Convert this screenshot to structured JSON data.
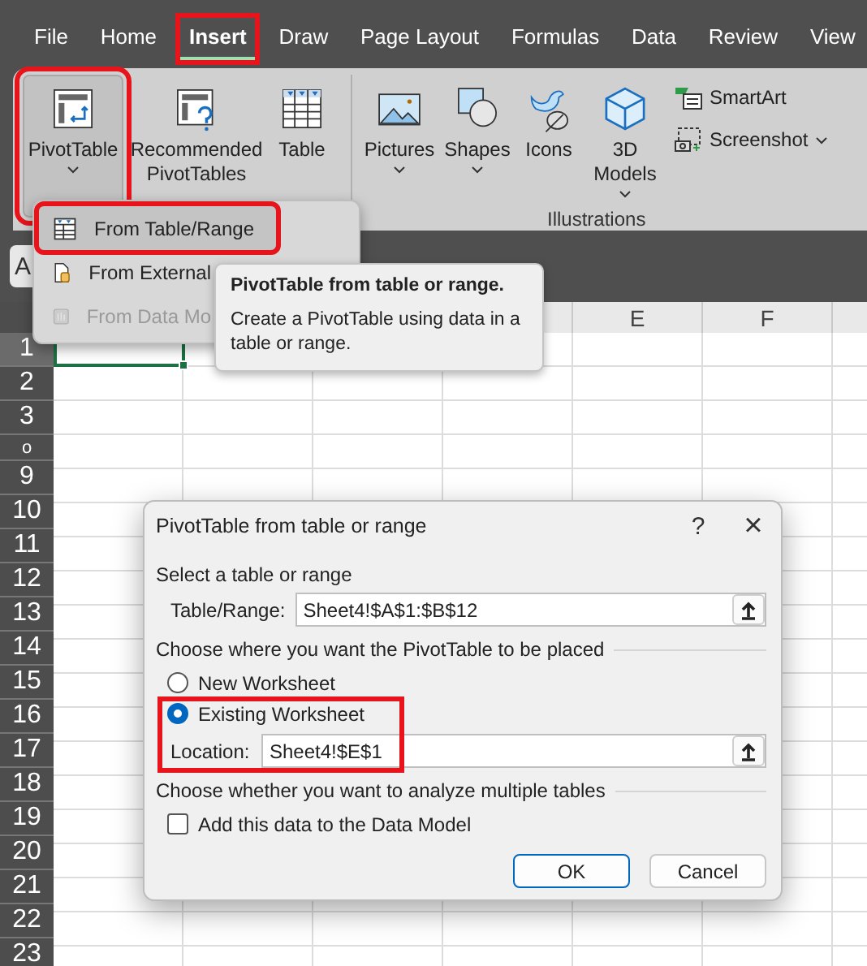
{
  "tabs": [
    {
      "label": "File",
      "selected": false,
      "highlighted": false
    },
    {
      "label": "Home",
      "selected": false,
      "highlighted": false
    },
    {
      "label": "Insert",
      "selected": true,
      "highlighted": true
    },
    {
      "label": "Draw",
      "selected": false,
      "highlighted": false
    },
    {
      "label": "Page Layout",
      "selected": false,
      "highlighted": false
    },
    {
      "label": "Formulas",
      "selected": false,
      "highlighted": false
    },
    {
      "label": "Data",
      "selected": false,
      "highlighted": false
    },
    {
      "label": "Review",
      "selected": false,
      "highlighted": false
    },
    {
      "label": "View",
      "selected": false,
      "highlighted": false
    }
  ],
  "ribbon": {
    "groups": [
      {
        "buttons": [
          {
            "kind": "pivot",
            "label": "PivotTable",
            "caret": true,
            "highlighted": true,
            "pressed": true
          },
          {
            "kind": "recommended",
            "label": "Recommended PivotTables",
            "caret": false,
            "highlighted": false,
            "pressed": false
          },
          {
            "kind": "table",
            "label": "Table",
            "caret": false,
            "highlighted": false,
            "pressed": false
          }
        ]
      },
      {
        "label": "Illustrations",
        "buttons": [
          {
            "kind": "pictures",
            "label": "Pictures",
            "caret": true,
            "highlighted": false,
            "pressed": false
          },
          {
            "kind": "shapes",
            "label": "Shapes",
            "caret": true,
            "highlighted": false,
            "pressed": false
          },
          {
            "kind": "icons",
            "label": "Icons",
            "caret": false,
            "highlighted": false,
            "pressed": false
          },
          {
            "kind": "models",
            "label": "3D Models",
            "caret": true,
            "highlighted": false,
            "pressed": false
          }
        ],
        "small_buttons": [
          {
            "kind": "smartart",
            "label": "SmartArt",
            "caret": false
          },
          {
            "kind": "screenshot",
            "label": "Screenshot",
            "caret": true
          }
        ]
      }
    ]
  },
  "name_box": {
    "value": "A"
  },
  "columns": [
    "E",
    "F"
  ],
  "rows": [
    {
      "label": "1",
      "selected": true,
      "kind": "normal"
    },
    {
      "label": "2",
      "selected": false,
      "kind": "normal"
    },
    {
      "label": "3",
      "selected": false,
      "kind": "normal"
    },
    {
      "label": "o",
      "selected": false,
      "kind": "short"
    },
    {
      "label": "9",
      "selected": false,
      "kind": "normal"
    },
    {
      "label": "10",
      "selected": false,
      "kind": "normal"
    },
    {
      "label": "11",
      "selected": false,
      "kind": "normal"
    },
    {
      "label": "12",
      "selected": false,
      "kind": "normal"
    },
    {
      "label": "13",
      "selected": false,
      "kind": "normal"
    },
    {
      "label": "14",
      "selected": false,
      "kind": "normal"
    },
    {
      "label": "15",
      "selected": false,
      "kind": "normal"
    },
    {
      "label": "16",
      "selected": false,
      "kind": "normal"
    },
    {
      "label": "17",
      "selected": false,
      "kind": "normal"
    },
    {
      "label": "18",
      "selected": false,
      "kind": "normal"
    },
    {
      "label": "19",
      "selected": false,
      "kind": "normal"
    },
    {
      "label": "20",
      "selected": false,
      "kind": "normal"
    },
    {
      "label": "21",
      "selected": false,
      "kind": "normal"
    },
    {
      "label": "22",
      "selected": false,
      "kind": "normal"
    },
    {
      "label": "23",
      "selected": false,
      "kind": "normal"
    }
  ],
  "menu": {
    "items": [
      {
        "kind": "table",
        "label": "From Table/Range",
        "selected": true,
        "disabled": false,
        "highlighted": true
      },
      {
        "kind": "external",
        "label": "From External",
        "selected": false,
        "disabled": false,
        "highlighted": false
      },
      {
        "kind": "model",
        "label": "From Data Mo",
        "selected": false,
        "disabled": true,
        "highlighted": false
      }
    ]
  },
  "tooltip": {
    "title": "PivotTable from table or range.",
    "body": "Create a PivotTable using data in a table or range."
  },
  "dialog": {
    "title": "PivotTable from table or range",
    "help": "?",
    "close": "×",
    "source_heading": "Select a table or range",
    "range": {
      "label": "Table/Range:",
      "value": "Sheet4!$A$1:$B$12"
    },
    "place_heading": "Choose where you want the PivotTable to be placed",
    "options": [
      {
        "label": "New Worksheet",
        "selected": false
      },
      {
        "label": "Existing Worksheet",
        "selected": true
      }
    ],
    "location": {
      "label": "Location:",
      "value": "Sheet4!$E$1",
      "highlighted": true
    },
    "multi_heading": "Choose whether you want to analyze multiple tables",
    "data_model": {
      "label": "Add this data to the Data Model",
      "checked": false
    },
    "buttons": [
      {
        "label": "OK",
        "default": true
      },
      {
        "label": "Cancel",
        "default": false
      }
    ]
  }
}
